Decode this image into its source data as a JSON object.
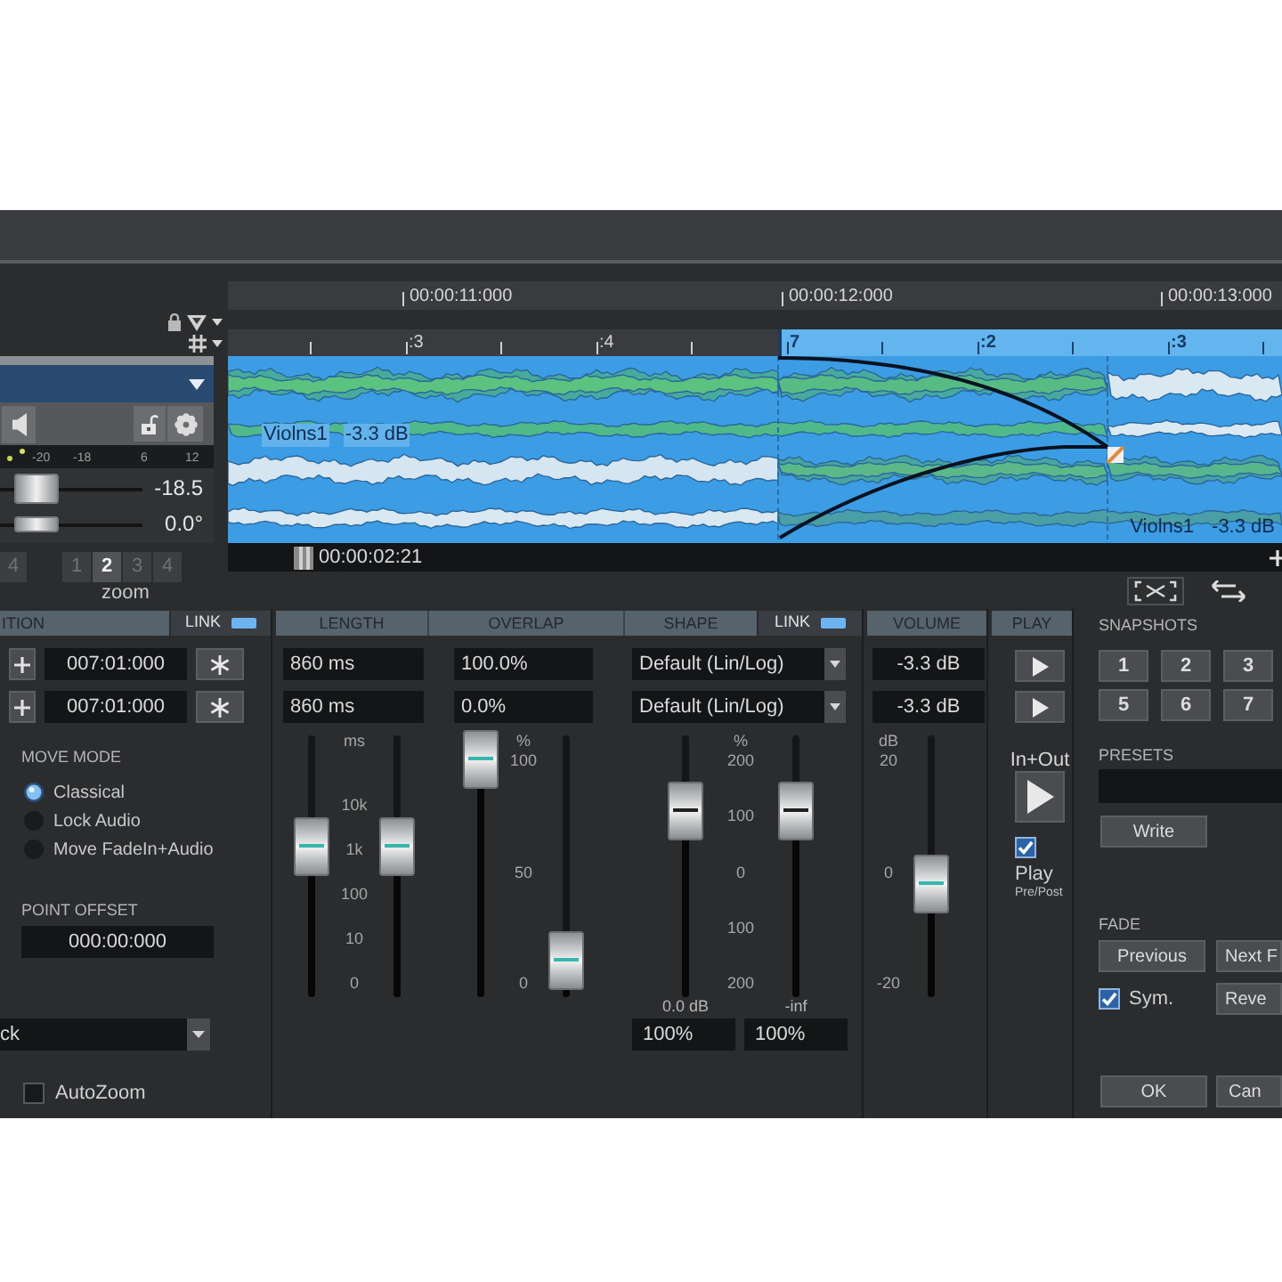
{
  "track": {
    "meter_scale": [
      "-20",
      "-18",
      "6",
      "12"
    ],
    "sliders": [
      {
        "level": 0.15,
        "reading": "-18.5"
      },
      {
        "level": 0.15,
        "reading": "0.0°"
      }
    ],
    "zoom_buttons": [
      {
        "label": "4",
        "selected": false
      },
      {
        "label": "1",
        "selected": false
      },
      {
        "label": "2",
        "selected": true
      },
      {
        "label": "3",
        "selected": false
      },
      {
        "label": "4",
        "selected": false
      }
    ],
    "zoom_label": "zoom"
  },
  "timeline": {
    "time_marks": [
      "00:00:11:000",
      "00:00:12:000",
      "00:00:13:000"
    ],
    "bar_marks": [
      ":3",
      ":4",
      "7",
      ":2",
      ":3"
    ],
    "clips": [
      {
        "name": "Violns1",
        "gain": "-3.3 dB"
      },
      {
        "name": "Violns1",
        "gain": "-3.3 dB"
      }
    ],
    "cursor_time": "00:00:02:21"
  },
  "position": {
    "header": "ITION",
    "link": {
      "label": "LINK",
      "on": true
    },
    "fields": [
      "007:01:000",
      "007:01:000"
    ],
    "move_mode": {
      "label": "MOVE MODE",
      "options": [
        {
          "label": "Classical",
          "selected": true
        },
        {
          "label": "Lock Audio",
          "selected": false
        },
        {
          "label": "Move FadeIn+Audio",
          "selected": false
        }
      ]
    },
    "point_offset": {
      "label": "POINT OFFSET",
      "value": "000:00:000"
    },
    "dropdown": {
      "value": "ck"
    },
    "autozoom": {
      "label": "AutoZoom",
      "checked": false
    }
  },
  "length": {
    "header": "LENGTH",
    "fields": [
      "860 ms",
      "860 ms"
    ],
    "unit": "ms",
    "ticks": [
      "10k",
      "1k",
      "100",
      "10",
      "0"
    ],
    "faders": [
      {
        "level": 0.57
      },
      {
        "level": 0.57
      }
    ]
  },
  "overlap": {
    "header": "OVERLAP",
    "fields": [
      "100.0%",
      "0.0%"
    ],
    "unit": "%",
    "ticks": [
      "100",
      "50",
      "0"
    ],
    "faders": [
      {
        "level": 1
      },
      {
        "level": 0
      }
    ]
  },
  "shape": {
    "header": "SHAPE",
    "link": {
      "label": "LINK",
      "on": true
    },
    "curves": [
      "Default (Lin/Log)",
      "Default (Lin/Log)"
    ],
    "unit": "%",
    "ticks": [
      "200",
      "100",
      "0",
      "100",
      "200"
    ],
    "faders": [
      {
        "level": 0.74
      },
      {
        "level": 0.74
      }
    ],
    "readings": [
      "0.0 dB",
      "-inf"
    ],
    "fields": [
      "100%",
      "100%"
    ]
  },
  "volume": {
    "header": "VOLUME",
    "fields": [
      "-3.3 dB",
      "-3.3 dB"
    ],
    "unit": "dB",
    "ticks": [
      "20",
      "0",
      "-20"
    ],
    "faders": [
      {
        "level": 0.38
      }
    ]
  },
  "play": {
    "header": "PLAY",
    "label": "In+Out",
    "play_pre_post": {
      "label": "Play",
      "note": "Pre/Post",
      "checked": true
    }
  },
  "snapshots": {
    "label": "SNAPSHOTS",
    "buttons": [
      "1",
      "2",
      "3",
      "5",
      "6",
      "7"
    ]
  },
  "presets": {
    "label": "PRESETS",
    "button": "Write"
  },
  "fade": {
    "label": "FADE",
    "previous": "Previous",
    "next": "Next F",
    "sym": {
      "label": "Sym.",
      "checked": true
    },
    "reverse": "Reve"
  },
  "dialog_buttons": [
    "OK",
    "Can"
  ]
}
